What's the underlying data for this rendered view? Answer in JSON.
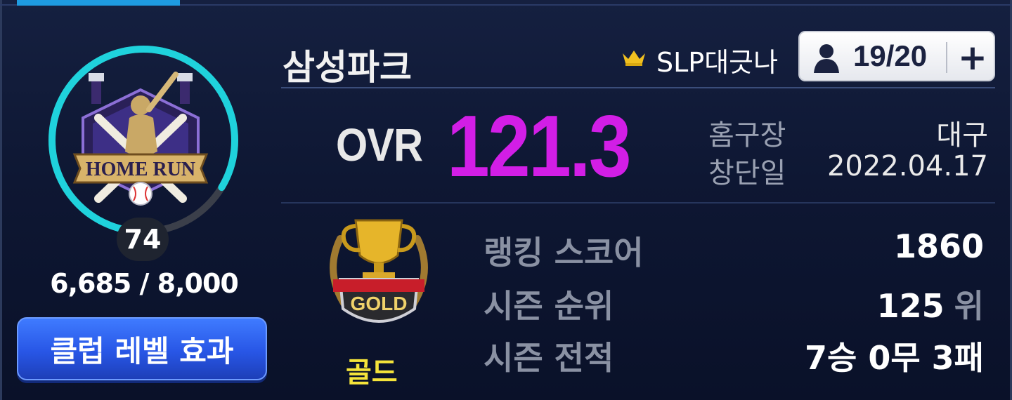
{
  "club": {
    "name": "삼성파크",
    "owner": "SLP대긋나",
    "members": "19/20",
    "add_label": "+"
  },
  "level": {
    "value": "74",
    "exp_text": "6,685 / 8,000",
    "progress": 0.836,
    "effect_button": "클럽 레벨 효과",
    "emblem_text": "HOME RUN"
  },
  "ovr": {
    "label": "OVR",
    "value": "121.3"
  },
  "info": [
    {
      "label": "홈구장",
      "value": "대구"
    },
    {
      "label": "창단일",
      "value": "2022.04.17"
    }
  ],
  "tier": {
    "name": "골드",
    "badge_text": "GOLD"
  },
  "stats": [
    {
      "label": "랭킹 스코어",
      "value": "1860",
      "unit": ""
    },
    {
      "label": "시즌 순위",
      "value": "125",
      "unit": "위"
    },
    {
      "label": "시즌 전적",
      "value": "7승 0무 3패",
      "unit": ""
    }
  ],
  "colors": {
    "ring": "#1fd2dc",
    "ovr": "#d21ee6",
    "button": "#2f63f0",
    "tier": "#f5e43a",
    "accent": "#1e9be0"
  }
}
